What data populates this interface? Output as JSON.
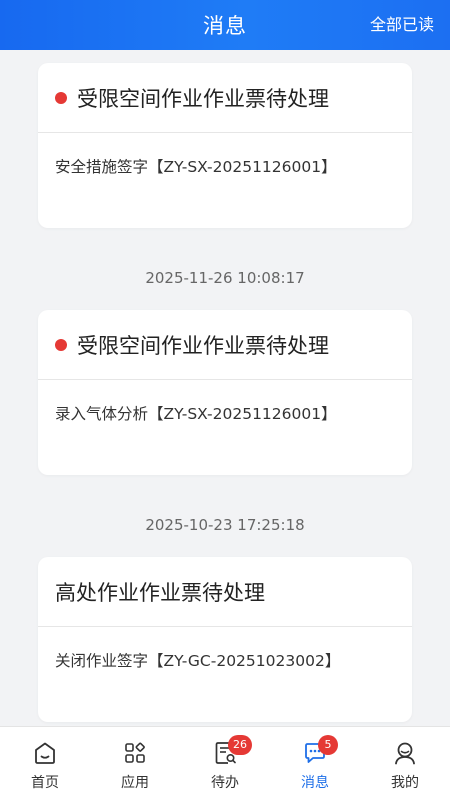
{
  "header": {
    "title": "消息",
    "mark_all_read": "全部已读"
  },
  "messages": [
    {
      "title": "受限空间作业作业票待处理",
      "body": "安全措施签字【ZY-SX-20251126001】",
      "unread": true
    },
    {
      "time": "2025-11-26 10:08:17",
      "title": "受限空间作业作业票待处理",
      "body": "录入气体分析【ZY-SX-20251126001】",
      "unread": true
    },
    {
      "time": "2025-10-23 17:25:18",
      "title": "高处作业作业票待处理",
      "body": "关闭作业签字【ZY-GC-20251023002】",
      "unread": false
    }
  ],
  "tabbar": {
    "items": [
      {
        "label": "首页",
        "icon": "home-icon"
      },
      {
        "label": "应用",
        "icon": "apps-icon"
      },
      {
        "label": "待办",
        "icon": "todo-icon",
        "badge": "26"
      },
      {
        "label": "消息",
        "icon": "message-icon",
        "badge": "5",
        "active": true
      },
      {
        "label": "我的",
        "icon": "profile-icon"
      }
    ]
  },
  "colors": {
    "header_blue": "#1f74f4",
    "unread_dot": "#e53935",
    "badge": "#e53935",
    "active_tab": "#1f6fe8"
  }
}
